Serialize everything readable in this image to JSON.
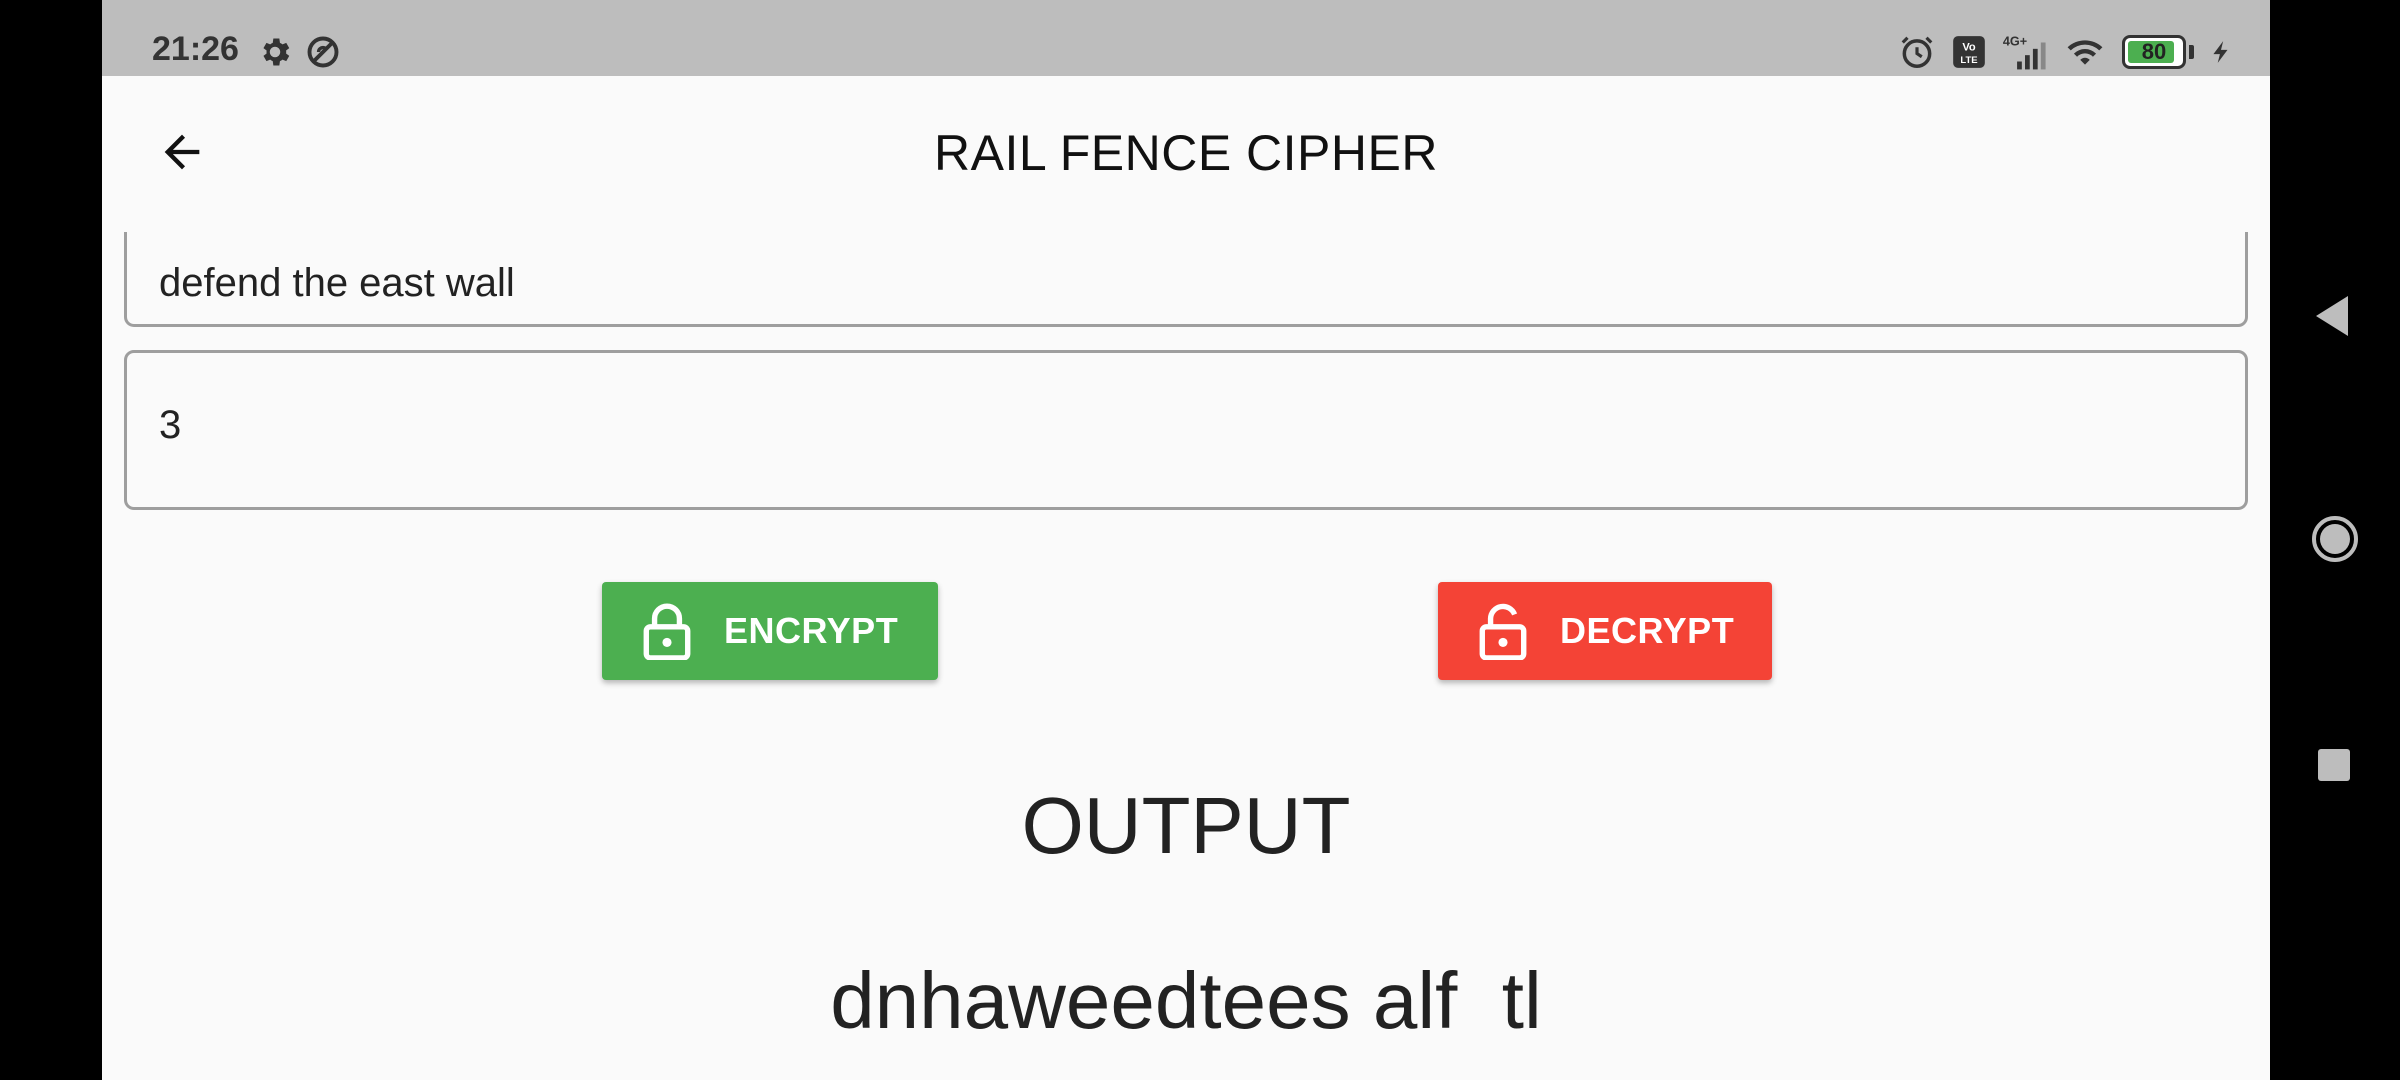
{
  "status_bar": {
    "time": "21:26",
    "icons": [
      "gear-icon",
      "sync-icon",
      "alarm-icon",
      "volte-icon",
      "signal-4g-icon",
      "wifi-icon",
      "battery-icon",
      "charging-icon"
    ],
    "network_label": "4G+",
    "volte_label": "Vo LTE",
    "battery_level": "80"
  },
  "app_bar": {
    "title": "RAIL FENCE CIPHER",
    "back_icon": "arrow-left-icon"
  },
  "form": {
    "plaintext_value": "defend the east wall",
    "key_value": "3"
  },
  "buttons": {
    "encrypt_label": "ENCRYPT",
    "decrypt_label": "DECRYPT"
  },
  "output": {
    "heading": "OUTPUT",
    "value": "dnhaweedtees alf  tl"
  },
  "colors": {
    "encrypt": "#4caf50",
    "decrypt": "#f44336",
    "status_bar": "#bdbdbd",
    "background": "#fafafa"
  },
  "nav_bar": {
    "icons": [
      "nav-back-icon",
      "nav-home-icon",
      "nav-recents-icon"
    ]
  }
}
